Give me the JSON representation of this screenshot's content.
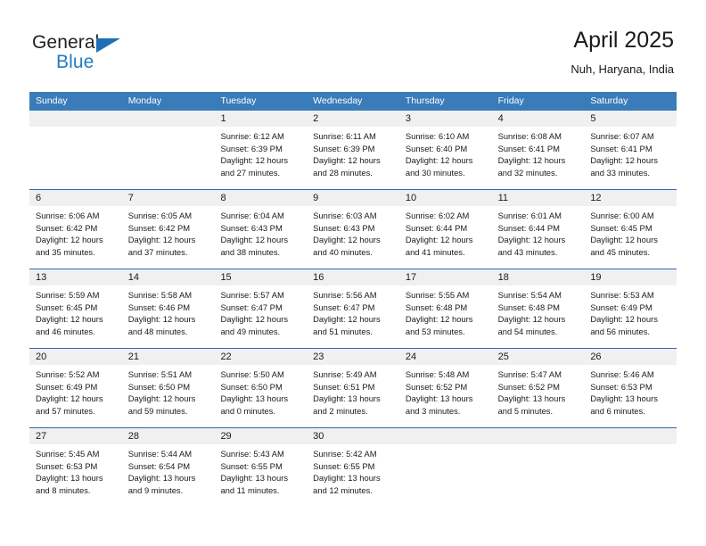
{
  "brand": {
    "name_part1": "General",
    "name_part2": "Blue",
    "triangle_icon": "brand-triangle-icon"
  },
  "header": {
    "title": "April 2025",
    "subtitle": "Nuh, Haryana, India"
  },
  "colors": {
    "header_blue": "#3a7cba",
    "row_divider_blue": "#2a6aa8",
    "daynum_band_gray": "#f0f0f0",
    "brand_blue": "#1f7cc4",
    "text": "#1a1a1a"
  },
  "weekdays": [
    "Sunday",
    "Monday",
    "Tuesday",
    "Wednesday",
    "Thursday",
    "Friday",
    "Saturday"
  ],
  "weeks": [
    [
      {
        "day": "",
        "lines": [],
        "empty": true
      },
      {
        "day": "",
        "lines": [],
        "empty": true
      },
      {
        "day": "1",
        "lines": [
          "Sunrise: 6:12 AM",
          "Sunset: 6:39 PM",
          "Daylight: 12 hours",
          "and 27 minutes."
        ],
        "empty": false
      },
      {
        "day": "2",
        "lines": [
          "Sunrise: 6:11 AM",
          "Sunset: 6:39 PM",
          "Daylight: 12 hours",
          "and 28 minutes."
        ],
        "empty": false
      },
      {
        "day": "3",
        "lines": [
          "Sunrise: 6:10 AM",
          "Sunset: 6:40 PM",
          "Daylight: 12 hours",
          "and 30 minutes."
        ],
        "empty": false
      },
      {
        "day": "4",
        "lines": [
          "Sunrise: 6:08 AM",
          "Sunset: 6:41 PM",
          "Daylight: 12 hours",
          "and 32 minutes."
        ],
        "empty": false
      },
      {
        "day": "5",
        "lines": [
          "Sunrise: 6:07 AM",
          "Sunset: 6:41 PM",
          "Daylight: 12 hours",
          "and 33 minutes."
        ],
        "empty": false
      }
    ],
    [
      {
        "day": "6",
        "lines": [
          "Sunrise: 6:06 AM",
          "Sunset: 6:42 PM",
          "Daylight: 12 hours",
          "and 35 minutes."
        ],
        "empty": false
      },
      {
        "day": "7",
        "lines": [
          "Sunrise: 6:05 AM",
          "Sunset: 6:42 PM",
          "Daylight: 12 hours",
          "and 37 minutes."
        ],
        "empty": false
      },
      {
        "day": "8",
        "lines": [
          "Sunrise: 6:04 AM",
          "Sunset: 6:43 PM",
          "Daylight: 12 hours",
          "and 38 minutes."
        ],
        "empty": false
      },
      {
        "day": "9",
        "lines": [
          "Sunrise: 6:03 AM",
          "Sunset: 6:43 PM",
          "Daylight: 12 hours",
          "and 40 minutes."
        ],
        "empty": false
      },
      {
        "day": "10",
        "lines": [
          "Sunrise: 6:02 AM",
          "Sunset: 6:44 PM",
          "Daylight: 12 hours",
          "and 41 minutes."
        ],
        "empty": false
      },
      {
        "day": "11",
        "lines": [
          "Sunrise: 6:01 AM",
          "Sunset: 6:44 PM",
          "Daylight: 12 hours",
          "and 43 minutes."
        ],
        "empty": false
      },
      {
        "day": "12",
        "lines": [
          "Sunrise: 6:00 AM",
          "Sunset: 6:45 PM",
          "Daylight: 12 hours",
          "and 45 minutes."
        ],
        "empty": false
      }
    ],
    [
      {
        "day": "13",
        "lines": [
          "Sunrise: 5:59 AM",
          "Sunset: 6:45 PM",
          "Daylight: 12 hours",
          "and 46 minutes."
        ],
        "empty": false
      },
      {
        "day": "14",
        "lines": [
          "Sunrise: 5:58 AM",
          "Sunset: 6:46 PM",
          "Daylight: 12 hours",
          "and 48 minutes."
        ],
        "empty": false
      },
      {
        "day": "15",
        "lines": [
          "Sunrise: 5:57 AM",
          "Sunset: 6:47 PM",
          "Daylight: 12 hours",
          "and 49 minutes."
        ],
        "empty": false
      },
      {
        "day": "16",
        "lines": [
          "Sunrise: 5:56 AM",
          "Sunset: 6:47 PM",
          "Daylight: 12 hours",
          "and 51 minutes."
        ],
        "empty": false
      },
      {
        "day": "17",
        "lines": [
          "Sunrise: 5:55 AM",
          "Sunset: 6:48 PM",
          "Daylight: 12 hours",
          "and 53 minutes."
        ],
        "empty": false
      },
      {
        "day": "18",
        "lines": [
          "Sunrise: 5:54 AM",
          "Sunset: 6:48 PM",
          "Daylight: 12 hours",
          "and 54 minutes."
        ],
        "empty": false
      },
      {
        "day": "19",
        "lines": [
          "Sunrise: 5:53 AM",
          "Sunset: 6:49 PM",
          "Daylight: 12 hours",
          "and 56 minutes."
        ],
        "empty": false
      }
    ],
    [
      {
        "day": "20",
        "lines": [
          "Sunrise: 5:52 AM",
          "Sunset: 6:49 PM",
          "Daylight: 12 hours",
          "and 57 minutes."
        ],
        "empty": false
      },
      {
        "day": "21",
        "lines": [
          "Sunrise: 5:51 AM",
          "Sunset: 6:50 PM",
          "Daylight: 12 hours",
          "and 59 minutes."
        ],
        "empty": false
      },
      {
        "day": "22",
        "lines": [
          "Sunrise: 5:50 AM",
          "Sunset: 6:50 PM",
          "Daylight: 13 hours",
          "and 0 minutes."
        ],
        "empty": false
      },
      {
        "day": "23",
        "lines": [
          "Sunrise: 5:49 AM",
          "Sunset: 6:51 PM",
          "Daylight: 13 hours",
          "and 2 minutes."
        ],
        "empty": false
      },
      {
        "day": "24",
        "lines": [
          "Sunrise: 5:48 AM",
          "Sunset: 6:52 PM",
          "Daylight: 13 hours",
          "and 3 minutes."
        ],
        "empty": false
      },
      {
        "day": "25",
        "lines": [
          "Sunrise: 5:47 AM",
          "Sunset: 6:52 PM",
          "Daylight: 13 hours",
          "and 5 minutes."
        ],
        "empty": false
      },
      {
        "day": "26",
        "lines": [
          "Sunrise: 5:46 AM",
          "Sunset: 6:53 PM",
          "Daylight: 13 hours",
          "and 6 minutes."
        ],
        "empty": false
      }
    ],
    [
      {
        "day": "27",
        "lines": [
          "Sunrise: 5:45 AM",
          "Sunset: 6:53 PM",
          "Daylight: 13 hours",
          "and 8 minutes."
        ],
        "empty": false
      },
      {
        "day": "28",
        "lines": [
          "Sunrise: 5:44 AM",
          "Sunset: 6:54 PM",
          "Daylight: 13 hours",
          "and 9 minutes."
        ],
        "empty": false
      },
      {
        "day": "29",
        "lines": [
          "Sunrise: 5:43 AM",
          "Sunset: 6:55 PM",
          "Daylight: 13 hours",
          "and 11 minutes."
        ],
        "empty": false
      },
      {
        "day": "30",
        "lines": [
          "Sunrise: 5:42 AM",
          "Sunset: 6:55 PM",
          "Daylight: 13 hours",
          "and 12 minutes."
        ],
        "empty": false
      },
      {
        "day": "",
        "lines": [],
        "empty": true
      },
      {
        "day": "",
        "lines": [],
        "empty": true
      },
      {
        "day": "",
        "lines": [],
        "empty": true
      }
    ]
  ]
}
